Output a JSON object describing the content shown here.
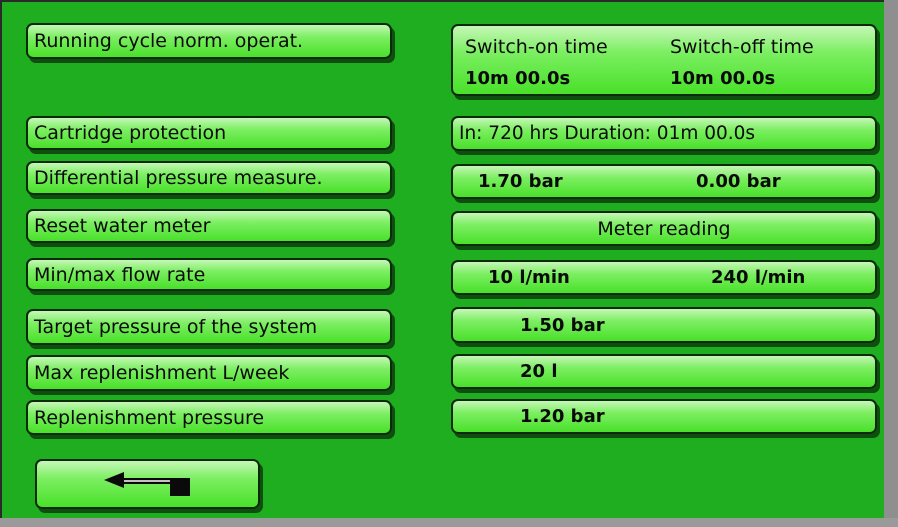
{
  "menu": {
    "running_cycle": "Running cycle norm. operat.",
    "cartridge_protection": "Cartridge protection",
    "differential_pressure": "Differential pressure measure.",
    "reset_water_meter": "Reset water meter",
    "min_max_flow": "Min/max flow rate",
    "target_pressure": "Target pressure of the system",
    "max_replenishment": "Max replenishment L/week",
    "replenishment_pressure": "Replenishment pressure"
  },
  "values": {
    "switch_on_label": "Switch-on time",
    "switch_off_label": "Switch-off time",
    "switch_on_value": "10m 00.0s",
    "switch_off_value": "10m 00.0s",
    "cartridge": "In: 720 hrs Duration: 01m 00.0s",
    "diff_pressure_1": "1.70 bar",
    "diff_pressure_2": "0.00 bar",
    "meter_reading": "Meter reading",
    "flow_min": "10 l/min",
    "flow_max": "240 l/min",
    "target_pressure": "1.50 bar",
    "max_replenishment": "20 l",
    "replenishment_pressure": "1.20 bar"
  },
  "navigation": {
    "back_icon": "back-arrow-icon"
  },
  "colors": {
    "background": "#1fae1f",
    "button_light": "#c6f7b8",
    "button_dark": "#49e02a"
  }
}
